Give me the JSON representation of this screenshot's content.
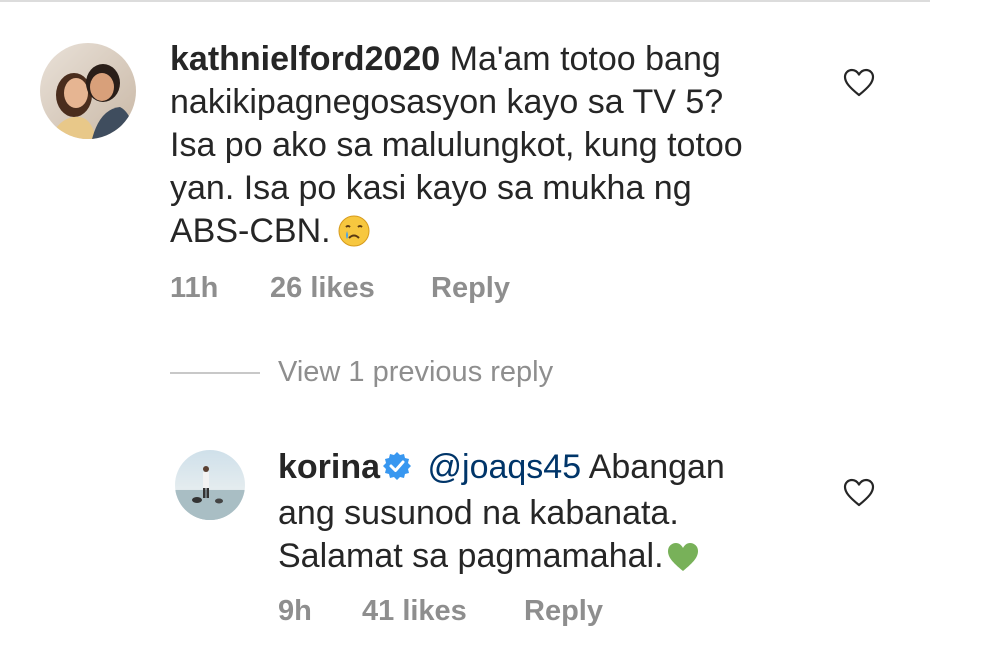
{
  "comment1": {
    "username": "kathnielford2020",
    "lines": [
      "Ma'am totoo bang",
      "nakikipagnegosasyon kayo sa TV 5?",
      "Isa po ako sa malulungkot, kung totoo",
      "yan. Isa po kasi kayo sa mukha ng",
      "ABS-CBN."
    ],
    "emoji": "crying-face",
    "time": "11h",
    "likes": "26 likes",
    "reply_label": "Reply"
  },
  "view_previous": "View 1 previous reply",
  "comment2": {
    "username": "korina",
    "verified": true,
    "mention": "@joaqs45",
    "lines": [
      "Abangan",
      "ang susunod na kabanata.",
      "Salamat sa pagmamahal."
    ],
    "emoji": "green-heart",
    "time": "9h",
    "likes": "41 likes",
    "reply_label": "Reply"
  },
  "colors": {
    "text": "#262626",
    "meta": "#8e8e8e",
    "mention": "#003569",
    "verified": "#3897f0",
    "green_heart": "#78b159"
  },
  "icons": [
    "heart-icon",
    "verified-badge-icon",
    "crying-face-emoji",
    "green-heart-emoji"
  ]
}
